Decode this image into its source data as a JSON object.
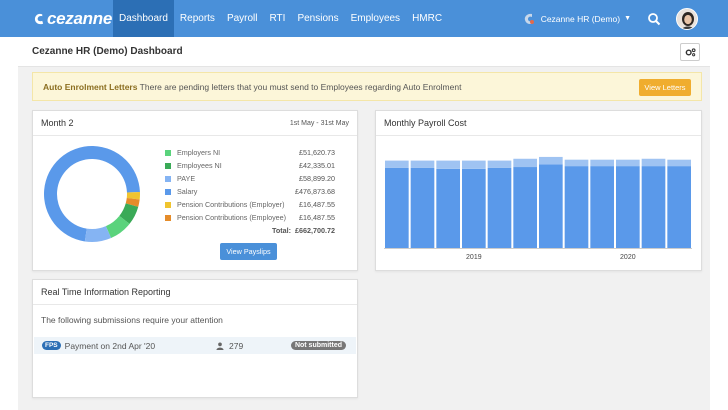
{
  "brand": {
    "name": "cezanne"
  },
  "nav": {
    "items": [
      {
        "label": "Dashboard"
      },
      {
        "label": "Reports"
      },
      {
        "label": "Payroll"
      },
      {
        "label": "RTI"
      },
      {
        "label": "Pensions"
      },
      {
        "label": "Employees"
      },
      {
        "label": "HMRC"
      }
    ]
  },
  "user_menu": {
    "company": "Cezanne HR (Demo)"
  },
  "page": {
    "title": "Cezanne HR (Demo) Dashboard"
  },
  "alert": {
    "title": "Auto Enrolment Letters",
    "message": "There are pending letters that you must send to Employees regarding Auto Enrolment",
    "button": "View Letters"
  },
  "month_card": {
    "title": "Month 2",
    "date_range": "1st May - 31st May",
    "legend": [
      {
        "label": "Employers NI",
        "value": "£51,620.73",
        "color": "#5ad37c"
      },
      {
        "label": "Employees NI",
        "value": "£42,335.01",
        "color": "#3aaa57"
      },
      {
        "label": "PAYE",
        "value": "£58,899.20",
        "color": "#85b4f3"
      },
      {
        "label": "Salary",
        "value": "£476,873.68",
        "color": "#5a99ea"
      },
      {
        "label": "Pension Contributions (Employer)",
        "value": "£16,487.55",
        "color": "#f0c42f"
      },
      {
        "label": "Pension Contributions (Employee)",
        "value": "£16,487.55",
        "color": "#e58c2a"
      }
    ],
    "total_label": "Total:",
    "total_value": "£662,700.72",
    "button": "View Payslips"
  },
  "payroll_card": {
    "title": "Monthly Payroll Cost"
  },
  "chart_data": {
    "type": "bar",
    "stacked": true,
    "x_tick_labels": [
      "2019",
      "2020"
    ],
    "series": [
      {
        "color": "#5a99ea",
        "values": [
          87,
          87,
          86,
          86,
          87,
          88,
          91,
          89,
          89,
          89,
          89,
          89
        ]
      },
      {
        "color": "#9fc3f2",
        "values": [
          8,
          8,
          9,
          9,
          8,
          9,
          8,
          7,
          7,
          7,
          8,
          7
        ]
      }
    ],
    "ylim": [
      0,
      100
    ],
    "grid": false
  },
  "rti_card": {
    "title": "Real Time Information Reporting",
    "note": "The following submissions require your attention",
    "submissions": [
      {
        "badge": "FPS",
        "desc": "Payment on 2nd  Apr '20",
        "count": "279",
        "status": "Not submitted"
      }
    ]
  },
  "colors": {
    "topbar": "#4a90d9",
    "accent": "#2c6fb5",
    "alert_button": "#f0ad2e"
  }
}
